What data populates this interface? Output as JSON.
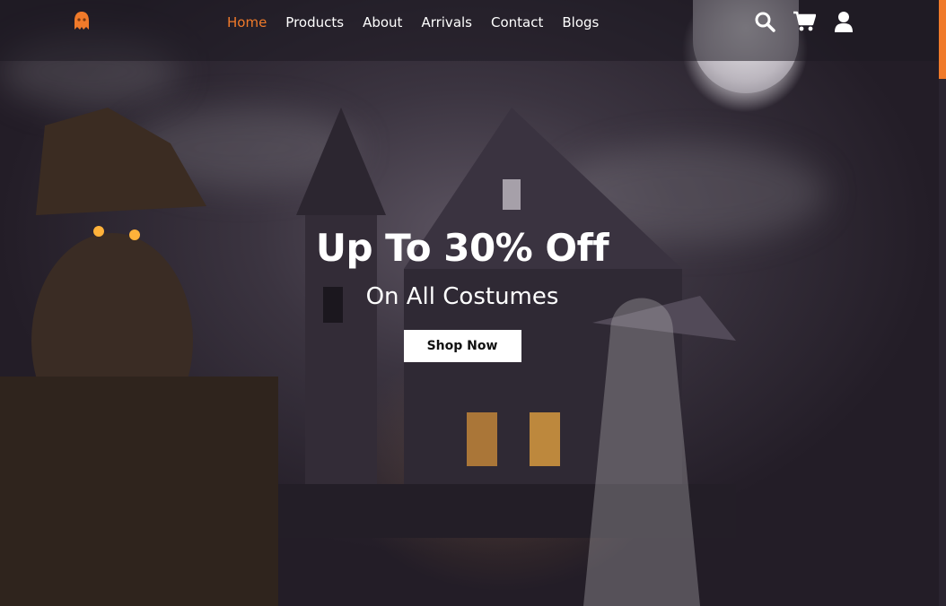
{
  "nav": {
    "logo_icon": "ghost-icon",
    "links": [
      {
        "label": "Home",
        "active": true
      },
      {
        "label": "Products",
        "active": false
      },
      {
        "label": "About",
        "active": false
      },
      {
        "label": "Arrivals",
        "active": false
      },
      {
        "label": "Contact",
        "active": false
      },
      {
        "label": "Blogs",
        "active": false
      }
    ],
    "icons": [
      "search-icon",
      "cart-icon",
      "user-icon"
    ]
  },
  "hero": {
    "title": "Up To 30% Off",
    "subtitle": "On All Costumes",
    "button_label": "Shop Now"
  },
  "colors": {
    "accent": "#f07a2a",
    "text": "#ffffff",
    "button_bg": "#ffffff"
  }
}
